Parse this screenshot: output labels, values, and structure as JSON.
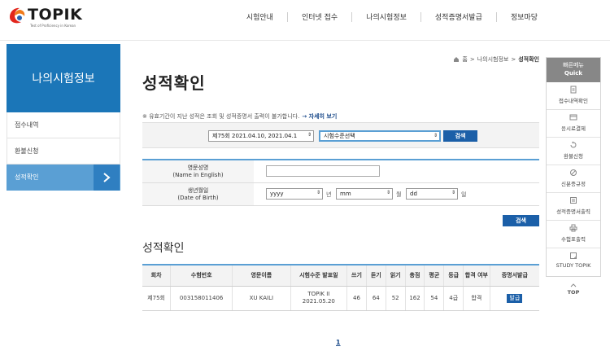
{
  "header": {
    "logo_text": "TOPIK",
    "logo_tagline": "Test of Proficiency in Korean",
    "nav": [
      "시험안내",
      "인터넷 접수",
      "나의시험정보",
      "성적증명서발급",
      "정보마당"
    ]
  },
  "sidebar": {
    "title": "나의시험정보",
    "items": [
      {
        "label": "접수내역"
      },
      {
        "label": "환불신청"
      },
      {
        "label": "성적확인"
      }
    ]
  },
  "breadcrumb": {
    "home": "홈",
    "parent": "나의시험정보",
    "current": "성적확인",
    "sep": ">"
  },
  "page_title": "성적확인",
  "notice": {
    "text": "※ 유효기간이 지난 성적은 조회 및 성적증명서 출력이 불가합니다.",
    "link": "→ 자세히 보기"
  },
  "search": {
    "exam_select": "제75회 2021.04.10, 2021.04.1",
    "level_select": "시험수준선택",
    "button": "검색"
  },
  "form": {
    "name_label": "영문성명",
    "name_label_en": "(Name in English)",
    "dob_label": "생년월일",
    "dob_label_en": "(Date of Birth)",
    "year": "yyyy",
    "year_unit": "년",
    "month": "mm",
    "month_unit": "월",
    "day": "dd",
    "day_unit": "일",
    "button": "검색"
  },
  "results": {
    "title": "성적확인",
    "headers": [
      "회차",
      "수험번호",
      "영문이름",
      "시험수준 발표일",
      "쓰기",
      "듣기",
      "읽기",
      "총점",
      "평균",
      "등급",
      "합격 여부",
      "증명서발급"
    ],
    "row": {
      "round": "제75회",
      "exam_no": "003158011406",
      "name": "XU KAILI",
      "level": "TOPIK II",
      "date": "2021.05.20",
      "writing": "46",
      "listening": "64",
      "reading": "52",
      "total": "162",
      "average": "54",
      "grade": "4급",
      "pass": "합격",
      "issue": "발급"
    }
  },
  "pagination": {
    "page": "1"
  },
  "quick_menu": {
    "title": "빠른메뉴",
    "title_en": "Quick",
    "items": [
      {
        "label": "접수내역확인",
        "icon": "document-icon"
      },
      {
        "label": "응시료결제",
        "icon": "card-icon"
      },
      {
        "label": "환불신청",
        "icon": "refund-icon"
      },
      {
        "label": "신분증규정",
        "icon": "prohibit-icon"
      },
      {
        "label": "성적증명서출력",
        "icon": "certificate-icon"
      },
      {
        "label": "수험표출력",
        "icon": "printer-icon"
      },
      {
        "label": "STUDY TOPIK",
        "icon": "book-icon"
      }
    ],
    "top": "TOP"
  },
  "colors": {
    "primary": "#1b76b8",
    "active": "#5a9fd4",
    "button": "#1b5fa8"
  }
}
